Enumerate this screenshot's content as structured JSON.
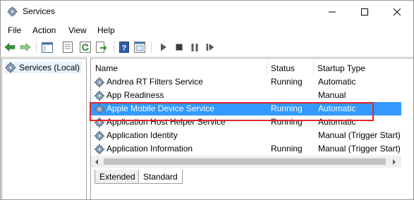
{
  "window": {
    "title": "Services",
    "icon": "gear-icon",
    "controls": [
      "minimize-icon",
      "maximize-icon",
      "close-icon"
    ]
  },
  "menu": {
    "file": "File",
    "action": "Action",
    "view": "View",
    "help": "Help"
  },
  "toolbar": {
    "buttons": [
      "back-icon",
      "forward-icon",
      "show-hide-tree-icon",
      "properties-icon",
      "refresh-icon",
      "export-list-icon",
      "help-icon",
      "view-icon",
      "start-service-icon",
      "stop-service-icon",
      "pause-service-icon",
      "restart-service-icon"
    ]
  },
  "tree": {
    "root_label": "Services (Local)"
  },
  "columns": {
    "name": "Name",
    "status": "Status",
    "startup_type": "Startup Type"
  },
  "rows": [
    {
      "name": "Andrea RT Filters Service",
      "status": "Running",
      "startup": "Automatic"
    },
    {
      "name": "App Readiness",
      "status": "",
      "startup": "Manual"
    },
    {
      "name": "Apple Mobile Device Service",
      "status": "Running",
      "startup": "Automatic"
    },
    {
      "name": "Application Host Helper Service",
      "status": "Running",
      "startup": "Automatic"
    },
    {
      "name": "Application Identity",
      "status": "",
      "startup": "Manual (Trigger Start)"
    },
    {
      "name": "Application Information",
      "status": "Running",
      "startup": "Manual (Trigger Start)"
    }
  ],
  "tabs": {
    "extended": "Extended",
    "standard": "Standard"
  },
  "colors": {
    "selection": "#3399ff",
    "highlight_box": "#e0262c"
  }
}
